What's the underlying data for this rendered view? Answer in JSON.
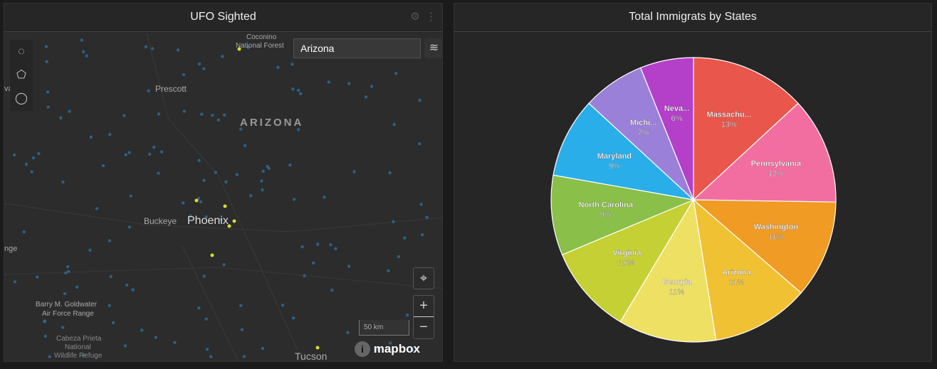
{
  "left_panel": {
    "title": "UFO Sighted",
    "search_value": "Arizona",
    "scale": "50 km",
    "attribution": "mapbox",
    "labels": {
      "coconino": "Coconino",
      "forest": "National Forest",
      "prescott": "Prescott",
      "arizona": "ARIZONA",
      "buckeye": "Buckeye",
      "phoenix": "Phoenix",
      "goldwater1": "Barry M. Goldwater",
      "goldwater2": "Air Force Range",
      "cabeza1": "Cabeza Prieta",
      "cabeza2": "National",
      "cabeza3": "Wildlife Refuge",
      "tucson": "Tucson",
      "va": "va",
      "nge": "nge"
    }
  },
  "right_panel": {
    "title": "Total Immigrats by States"
  },
  "chart_data": {
    "type": "pie",
    "title": "Total Immigrats by States",
    "slices": [
      {
        "label": "Massachu...",
        "value": 13,
        "pct": "13%",
        "color": "#e9564b"
      },
      {
        "label": "Pennsylvania",
        "value": 12,
        "pct": "12%",
        "color": "#f26ea1"
      },
      {
        "label": "Washington",
        "value": 11,
        "pct": "11%",
        "color": "#f09b24"
      },
      {
        "label": "Arizona",
        "value": 11,
        "pct": "11%",
        "color": "#f0c133"
      },
      {
        "label": "Georgia",
        "value": 11,
        "pct": "11%",
        "color": "#eee062"
      },
      {
        "label": "Virginia",
        "value": 10,
        "pct": "10%",
        "color": "#c5d034"
      },
      {
        "label": "North Carolina",
        "value": 9,
        "pct": "9%",
        "color": "#8abf49"
      },
      {
        "label": "Maryland",
        "value": 9,
        "pct": "9%",
        "color": "#2aaeea"
      },
      {
        "label": "Michi...",
        "value": 7,
        "pct": "7%",
        "color": "#9b80d9"
      },
      {
        "label": "Neva...",
        "value": 6,
        "pct": "6%",
        "color": "#b43fc9"
      }
    ]
  }
}
